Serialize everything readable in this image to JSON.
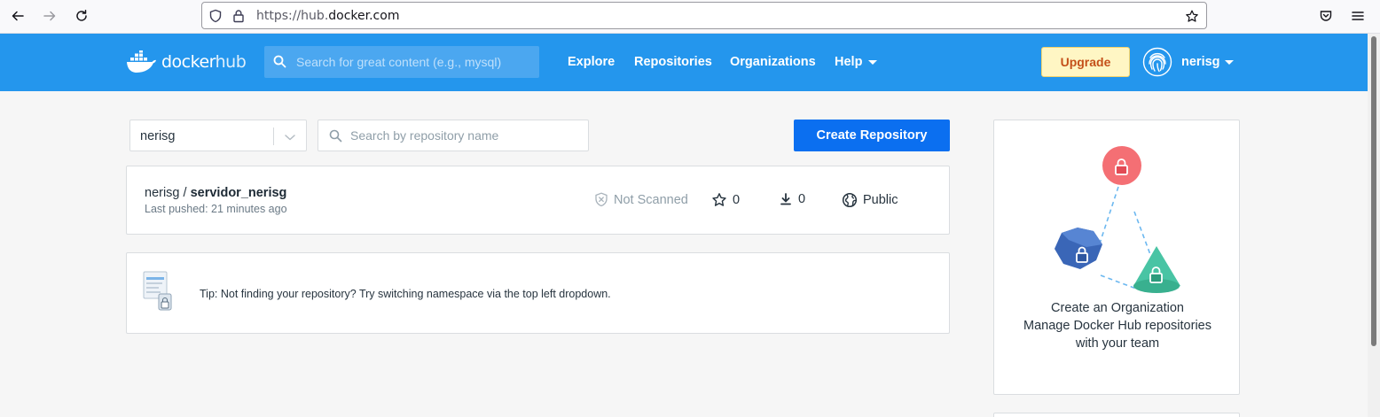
{
  "browser": {
    "url_prefix": "https://hub.",
    "url_domain": "docker.com",
    "icons": [
      "back-icon",
      "forward-icon",
      "reload-icon",
      "shield-icon",
      "lock-icon",
      "star-icon",
      "pocket-icon",
      "menu-icon"
    ]
  },
  "header": {
    "logo_part1": "docker",
    "logo_part2": "hub",
    "search_placeholder": "Search for great content (e.g., mysql)",
    "nav": {
      "explore": "Explore",
      "repositories": "Repositories",
      "organizations": "Organizations",
      "help": "Help"
    },
    "upgrade_label": "Upgrade",
    "username": "nerisg",
    "brand_color": "#2496ed"
  },
  "toolbar": {
    "namespace": "nerisg",
    "repo_search_placeholder": "Search by repository name",
    "create_label": "Create Repository",
    "create_color": "#0b6ff0"
  },
  "repositories": [
    {
      "namespace": "nerisg",
      "separator": " / ",
      "name": "servidor_nerisg",
      "last_pushed": "Last pushed: 21 minutes ago",
      "scan_status": "Not Scanned",
      "stars": "0",
      "pulls": "0",
      "visibility": "Public"
    }
  ],
  "tip": {
    "text": "Tip: Not finding your repository? Try switching namespace via the top left dropdown."
  },
  "org_panel": {
    "title": "Create an Organization",
    "description": "Manage Docker Hub repositories with your team"
  }
}
